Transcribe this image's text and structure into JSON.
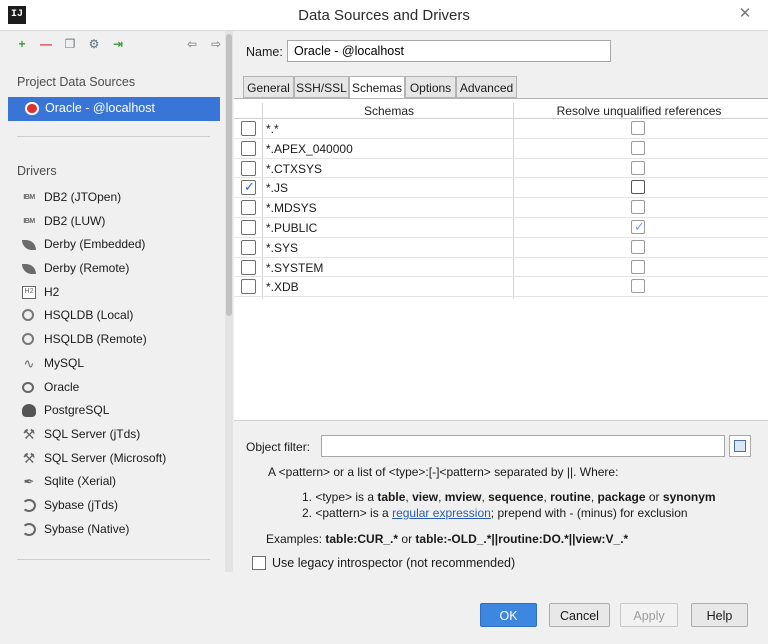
{
  "window": {
    "title": "Data Sources and Drivers",
    "app_icon_text": "IJ",
    "close_glyph": "✕"
  },
  "toolbar": {
    "icons": [
      {
        "name": "add-icon",
        "glyph": "+",
        "color": "#3a9a3a"
      },
      {
        "name": "remove-icon",
        "glyph": "—",
        "color": "#d93a3a"
      },
      {
        "name": "duplicate-icon",
        "glyph": "❐",
        "color": "#6b7a8b"
      },
      {
        "name": "settings-icon",
        "glyph": "⚙",
        "color": "#5a6b7c"
      },
      {
        "name": "import-icon",
        "glyph": "⇥",
        "color": "#3a9a3a"
      },
      {
        "name": "back-icon",
        "glyph": "⇦",
        "color": "#8a8a8a"
      },
      {
        "name": "forward-icon",
        "glyph": "⇨",
        "color": "#8a8a8a"
      }
    ]
  },
  "sidebar": {
    "project_title": "Project Data Sources",
    "project_item": "Oracle - @localhost",
    "drivers_title": "Drivers",
    "drivers": [
      {
        "label": "DB2 (JTOpen)",
        "icon": "ibm-icon"
      },
      {
        "label": "DB2 (LUW)",
        "icon": "ibm-icon"
      },
      {
        "label": "Derby (Embedded)",
        "icon": "derby-icon"
      },
      {
        "label": "Derby (Remote)",
        "icon": "derby-icon"
      },
      {
        "label": "H2",
        "icon": "h2-icon"
      },
      {
        "label": "HSQLDB (Local)",
        "icon": "hsqldb-icon"
      },
      {
        "label": "HSQLDB (Remote)",
        "icon": "hsqldb-icon"
      },
      {
        "label": "MySQL",
        "icon": "mysql-icon"
      },
      {
        "label": "Oracle",
        "icon": "oracle-icon"
      },
      {
        "label": "PostgreSQL",
        "icon": "postgresql-icon"
      },
      {
        "label": "SQL Server (jTds)",
        "icon": "sqlserver-icon"
      },
      {
        "label": "SQL Server (Microsoft)",
        "icon": "sqlserver-icon"
      },
      {
        "label": "Sqlite (Xerial)",
        "icon": "sqlite-icon"
      },
      {
        "label": "Sybase (jTds)",
        "icon": "sybase-icon"
      },
      {
        "label": "Sybase (Native)",
        "icon": "sybase-icon"
      }
    ]
  },
  "main": {
    "name_label": "Name:",
    "name_value": "Oracle - @localhost",
    "tabs": [
      {
        "label": "General",
        "active": false
      },
      {
        "label": "SSH/SSL",
        "active": false
      },
      {
        "label": "Schemas",
        "active": true
      },
      {
        "label": "Options",
        "active": false
      },
      {
        "label": "Advanced",
        "active": false
      }
    ],
    "table": {
      "headers": [
        "Schemas",
        "Resolve unqualified references"
      ],
      "rows": [
        {
          "pattern": "*.*",
          "selected": false,
          "resolve": false
        },
        {
          "pattern": "*.APEX_040000",
          "selected": false,
          "resolve": false
        },
        {
          "pattern": "*.CTXSYS",
          "selected": false,
          "resolve": false
        },
        {
          "pattern": "*.JS",
          "selected": true,
          "resolve": false
        },
        {
          "pattern": "*.MDSYS",
          "selected": false,
          "resolve": false
        },
        {
          "pattern": "*.PUBLIC",
          "selected": false,
          "resolve": true
        },
        {
          "pattern": "*.SYS",
          "selected": false,
          "resolve": false
        },
        {
          "pattern": "*.SYSTEM",
          "selected": false,
          "resolve": false
        },
        {
          "pattern": "*.XDB",
          "selected": false,
          "resolve": false
        }
      ]
    },
    "filter": {
      "label": "Object filter:",
      "value": "",
      "intro": "A <pattern> or a list of <type>:[-]<pattern> separated by ||. Where:",
      "item1_prefix": "1. <type> is a",
      "item1_types": [
        "table",
        "view",
        "mview",
        "sequence",
        "routine",
        "package"
      ],
      "item1_or": "or",
      "item1_last": "synonym",
      "item2_prefix": "2. <pattern> is a",
      "item2_link": "regular expression",
      "item2_suffix": "; prepend with - (minus) for exclusion",
      "examples_label": "Examples:",
      "example1": "table:CUR_.*",
      "examples_or": "or",
      "example2": "table:-OLD_.*||routine:DO.*||view:V_.*"
    },
    "legacy": {
      "label": "Use legacy introspector (not recommended)",
      "checked": false
    }
  },
  "buttons": {
    "ok": "OK",
    "cancel": "Cancel",
    "apply": "Apply",
    "help": "Help"
  },
  "colors": {
    "selection": "#3875d7",
    "primary_button": "#3d87e0",
    "check": "#2d63c8",
    "link": "#2a5db0"
  }
}
